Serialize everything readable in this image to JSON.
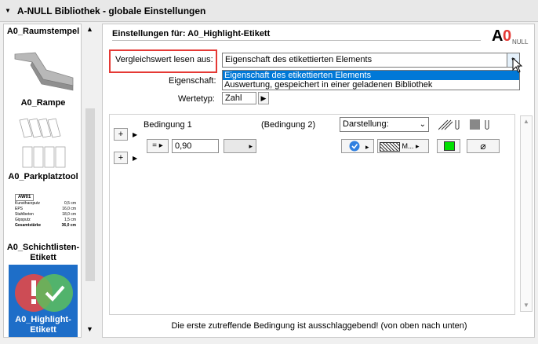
{
  "window": {
    "title": "A-NULL Bibliothek - globale Einstellungen"
  },
  "sidebar": {
    "items": [
      {
        "label": "A0_Raumstempel"
      },
      {
        "label": "A0_Rampe"
      },
      {
        "label": "A0_Parkplatztool"
      },
      {
        "label": "A0_Schichtlisten-Etikett"
      },
      {
        "label": "A0_Highlight-Etikett"
      }
    ],
    "schicht_thumb": {
      "code": "AW01",
      "rows": [
        [
          "Kunstharzputz",
          "0,5 cm"
        ],
        [
          "EPS",
          "16,0 cm"
        ],
        [
          "Stahlbeton",
          "18,0 cm"
        ],
        [
          "Gipsputz",
          "1,5 cm"
        ],
        [
          "Gesamtstärke",
          "36,0 cm"
        ]
      ]
    }
  },
  "main": {
    "header": "Einstellungen für: A0_Highlight-Etikett",
    "logo": {
      "a": "A",
      "zero": "0",
      "null": "NULL"
    },
    "vergleich_label": "Vergleichswert lesen aus:",
    "vergleich_value": "Eigenschaft des etikettierten Elements",
    "dropdown_options": [
      "Eigenschaft des etikettierten Elements",
      "Auswertung, gespeichert in einer geladenen Bibliothek"
    ],
    "eigenschaft_label": "Eigenschaft:",
    "wertetyp_label": "Wertetyp:",
    "wertetyp_value": "Zahl",
    "bedingung1": "Bedingung 1",
    "bedingung2": "(Bedingung 2)",
    "darstellung": "Darstellung:",
    "operator": "=",
    "value": "0,90",
    "fill_label": "M...",
    "footer": "Die erste zutreffende Bedingung ist ausschlaggebend! (von oben nach unten)"
  },
  "colors": {
    "accent": "#0078d7",
    "highlight_box": "#e53935",
    "green": "#00e000",
    "selection": "#1e6ec8"
  }
}
